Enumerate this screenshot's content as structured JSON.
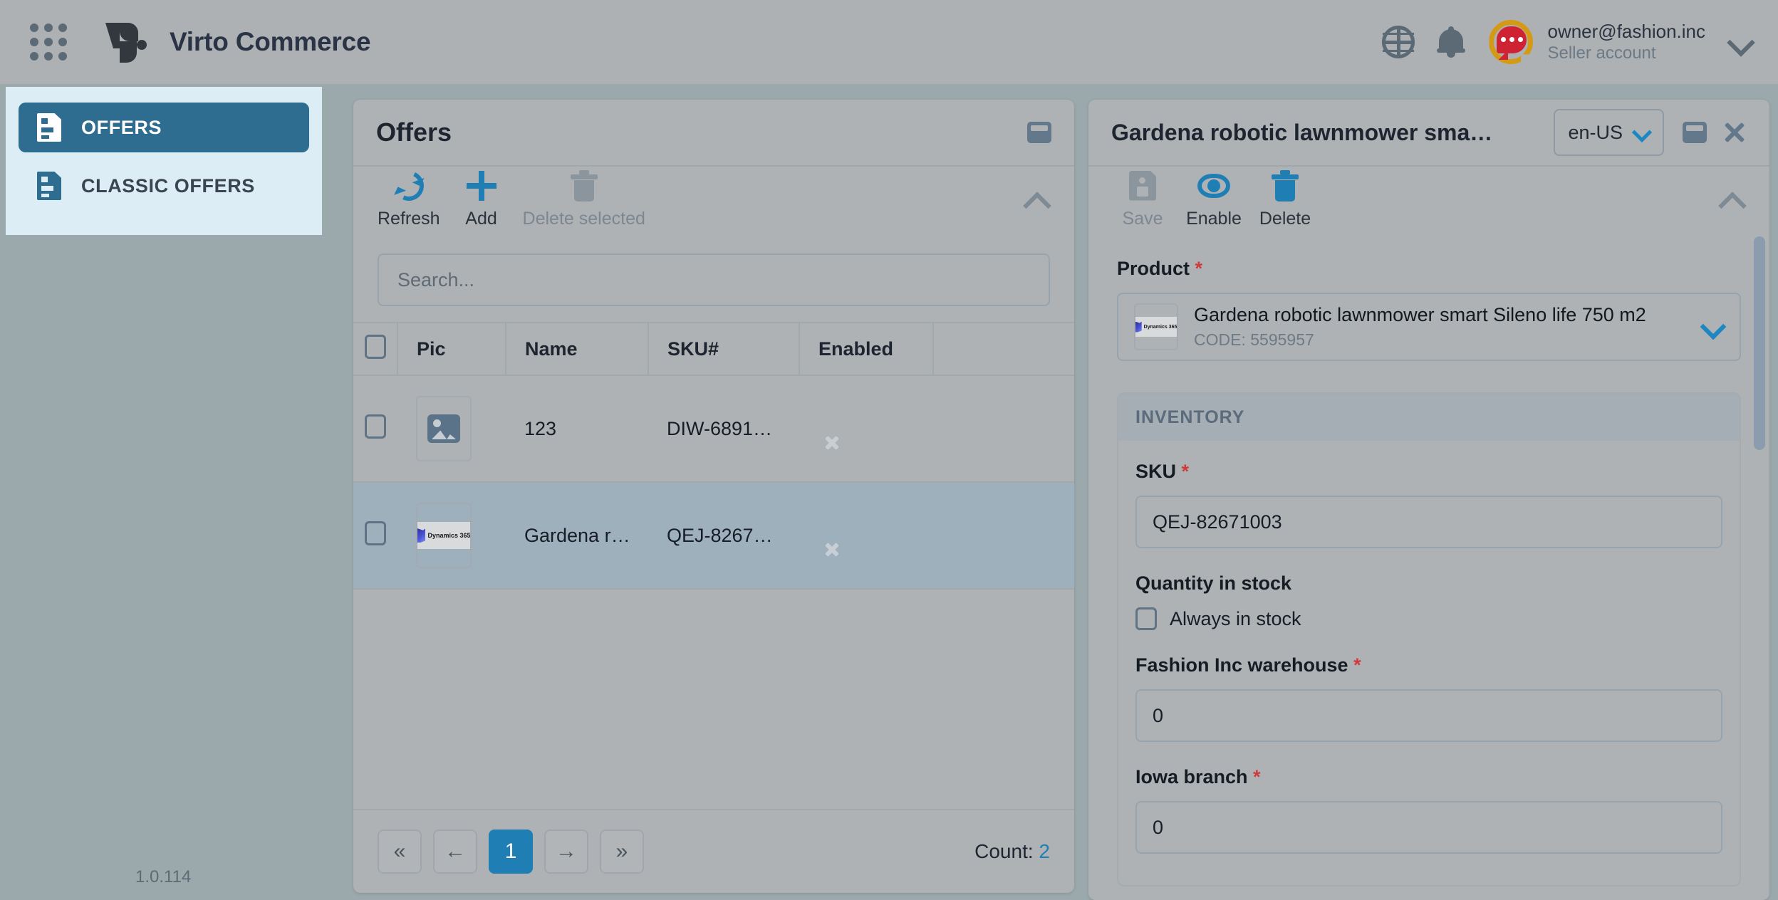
{
  "header": {
    "apps_icon": "grid-apps-icon",
    "brand": "Virto Commerce",
    "globe_icon": "globe-icon",
    "bell_icon": "bell-icon",
    "avatar_icon": "support-avatar-icon",
    "account_email": "owner@fashion.inc",
    "account_role": "Seller account",
    "chevron_icon": "chevron-down-icon"
  },
  "sidebar": {
    "items": [
      {
        "label": "OFFERS",
        "icon": "document-icon",
        "active": true
      },
      {
        "label": "CLASSIC OFFERS",
        "icon": "document-icon",
        "active": false
      }
    ]
  },
  "version": "1.0.114",
  "list_blade": {
    "title": "Offers",
    "window_icon": "window-restore-icon",
    "collapse_icon": "chevron-up-icon",
    "toolbar": [
      {
        "label": "Refresh",
        "icon": "refresh-icon",
        "disabled": false
      },
      {
        "label": "Add",
        "icon": "plus-icon",
        "disabled": false
      },
      {
        "label": "Delete selected",
        "icon": "trash-icon",
        "disabled": true
      }
    ],
    "search_placeholder": "Search...",
    "search_value": "",
    "table": {
      "columns": [
        "",
        "Pic",
        "Name",
        "SKU#",
        "Enabled",
        ""
      ],
      "rows": [
        {
          "pic": "image-placeholder-icon",
          "name": "123",
          "sku": "DIW-6891…",
          "enabled_icon": "disabled-circle-x-icon",
          "selected": false
        },
        {
          "pic": "dynamics-365-logo",
          "name": "Gardena r…",
          "sku": "QEJ-8267…",
          "enabled_icon": "disabled-circle-x-icon",
          "selected": true
        }
      ]
    },
    "pager": {
      "first": "«",
      "prev": "←",
      "current": "1",
      "next": "→",
      "last": "»",
      "count_label": "Count:",
      "count_value": "2"
    }
  },
  "detail_blade": {
    "title": "Gardena robotic lawnmower sma…",
    "language": "en-US",
    "language_chevron": "chevron-down-icon",
    "window_icon": "window-restore-icon",
    "close_icon": "close-icon",
    "collapse_icon": "chevron-up-icon",
    "toolbar": [
      {
        "label": "Save",
        "icon": "save-icon",
        "disabled": true
      },
      {
        "label": "Enable",
        "icon": "eye-icon",
        "disabled": false
      },
      {
        "label": "Delete",
        "icon": "trash-icon",
        "disabled": false
      }
    ],
    "product": {
      "label": "Product",
      "required": "*",
      "thumb": "dynamics-365-logo",
      "name": "Gardena robotic lawnmower smart Sileno life 750 m2",
      "code": "CODE: 5595957",
      "chevron": "chevron-down-icon"
    },
    "inventory": {
      "section_title": "INVENTORY",
      "sku_label": "SKU",
      "sku_required": "*",
      "sku_value": "QEJ-82671003",
      "quantity_label": "Quantity in stock",
      "always_in_stock_label": "Always in stock",
      "always_in_stock_checked": false,
      "warehouses": [
        {
          "label": "Fashion Inc warehouse",
          "required": "*",
          "value": "0"
        },
        {
          "label": "Iowa branch",
          "required": "*",
          "value": "0"
        }
      ]
    }
  },
  "colors": {
    "accent_blue": "#1f7fb4",
    "nav_active": "#2e6d8f",
    "nav_bg": "#dcedf5",
    "page_bg": "#9ba9ad",
    "blade_bg": "#aeb2b4",
    "required_red": "#cf3b3b",
    "row_selected": "#9fb0bd"
  }
}
